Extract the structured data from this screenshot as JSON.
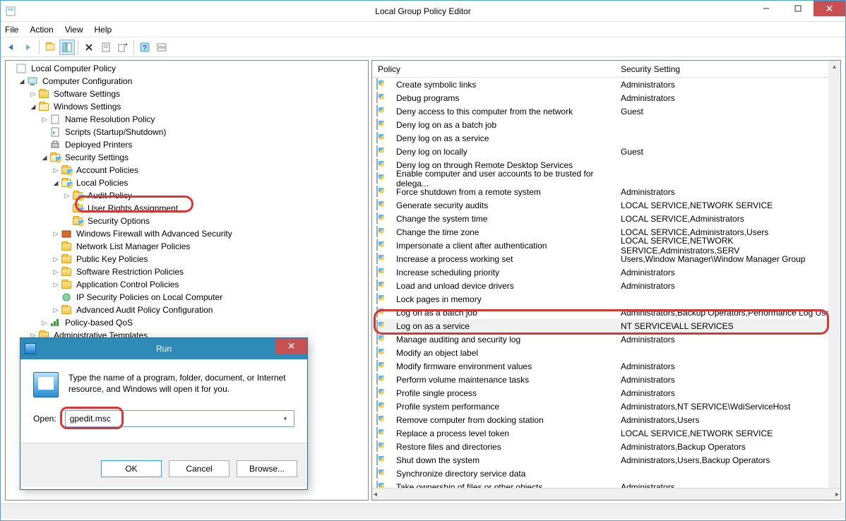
{
  "window": {
    "title": "Local Group Policy Editor"
  },
  "menubar": [
    "File",
    "Action",
    "View",
    "Help"
  ],
  "tree": {
    "root": "Local Computer Policy",
    "cc": "Computer Configuration",
    "ss": "Software Settings",
    "ws": "Windows Settings",
    "nrp": "Name Resolution Policy",
    "scripts": "Scripts (Startup/Shutdown)",
    "dp": "Deployed Printers",
    "secset": "Security Settings",
    "acc": "Account Policies",
    "locpol": "Local Policies",
    "audit": "Audit Policy",
    "ura": "User Rights Assignment",
    "secop": "Security Options",
    "wfas": "Windows Firewall with Advanced Security",
    "nlm": "Network List Manager Policies",
    "pkp": "Public Key Policies",
    "srp": "Software Restriction Policies",
    "acp": "Application Control Policies",
    "ipsec": "IP Security Policies on Local Computer",
    "aapc": "Advanced Audit Policy Configuration",
    "pbq": "Policy-based QoS",
    "at": "Administrative Templates"
  },
  "columns": {
    "policy": "Policy",
    "setting": "Security Setting"
  },
  "policies": [
    {
      "p": "Create symbolic links",
      "s": "Administrators"
    },
    {
      "p": "Debug programs",
      "s": "Administrators"
    },
    {
      "p": "Deny access to this computer from the network",
      "s": "Guest"
    },
    {
      "p": "Deny log on as a batch job",
      "s": ""
    },
    {
      "p": "Deny log on as a service",
      "s": ""
    },
    {
      "p": "Deny log on locally",
      "s": "Guest"
    },
    {
      "p": "Deny log on through Remote Desktop Services",
      "s": ""
    },
    {
      "p": "Enable computer and user accounts to be trusted for delega...",
      "s": ""
    },
    {
      "p": "Force shutdown from a remote system",
      "s": "Administrators"
    },
    {
      "p": "Generate security audits",
      "s": "LOCAL SERVICE,NETWORK SERVICE"
    },
    {
      "p": "Change the system time",
      "s": "LOCAL SERVICE,Administrators"
    },
    {
      "p": "Change the time zone",
      "s": "LOCAL SERVICE,Administrators,Users"
    },
    {
      "p": "Impersonate a client after authentication",
      "s": "LOCAL SERVICE,NETWORK SERVICE,Administrators,SERV"
    },
    {
      "p": "Increase a process working set",
      "s": "Users,Window Manager\\Window Manager Group"
    },
    {
      "p": "Increase scheduling priority",
      "s": "Administrators"
    },
    {
      "p": "Load and unload device drivers",
      "s": "Administrators"
    },
    {
      "p": "Lock pages in memory",
      "s": ""
    },
    {
      "p": "Log on as a batch job",
      "s": "Administrators,Backup Operators,Performance Log User"
    },
    {
      "p": "Log on as a service",
      "s": "NT SERVICE\\ALL SERVICES",
      "sel": true
    },
    {
      "p": "Manage auditing and security log",
      "s": "Administrators"
    },
    {
      "p": "Modify an object label",
      "s": ""
    },
    {
      "p": "Modify firmware environment values",
      "s": "Administrators"
    },
    {
      "p": "Perform volume maintenance tasks",
      "s": "Administrators"
    },
    {
      "p": "Profile single process",
      "s": "Administrators"
    },
    {
      "p": "Profile system performance",
      "s": "Administrators,NT SERVICE\\WdiServiceHost"
    },
    {
      "p": "Remove computer from docking station",
      "s": "Administrators,Users"
    },
    {
      "p": "Replace a process level token",
      "s": "LOCAL SERVICE,NETWORK SERVICE"
    },
    {
      "p": "Restore files and directories",
      "s": "Administrators,Backup Operators"
    },
    {
      "p": "Shut down the system",
      "s": "Administrators,Users,Backup Operators"
    },
    {
      "p": "Synchronize directory service data",
      "s": ""
    },
    {
      "p": "Take ownership of files or other objects",
      "s": "Administrators"
    }
  ],
  "run": {
    "title": "Run",
    "desc": "Type the name of a program, folder, document, or Internet resource, and Windows will open it for you.",
    "open_label": "Open:",
    "value": "gpedit.msc",
    "ok": "OK",
    "cancel": "Cancel",
    "browse": "Browse..."
  }
}
